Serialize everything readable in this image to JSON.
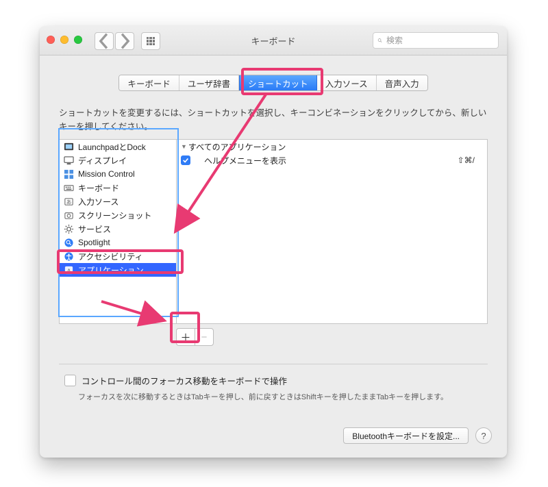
{
  "window": {
    "title": "キーボード",
    "search_placeholder": "検索"
  },
  "tabs": [
    {
      "label": "キーボード"
    },
    {
      "label": "ユーザ辞書"
    },
    {
      "label": "ショートカット",
      "active": true
    },
    {
      "label": "入力ソース"
    },
    {
      "label": "音声入力"
    }
  ],
  "instructions": "ショートカットを変更するには、ショートカットを選択し、キーコンビネーションをクリックしてから、新しいキーを押してください。",
  "categories": [
    {
      "label": "LaunchpadとDock",
      "icon": "launchpad"
    },
    {
      "label": "ディスプレイ",
      "icon": "display"
    },
    {
      "label": "Mission Control",
      "icon": "mission"
    },
    {
      "label": "キーボード",
      "icon": "keyboard"
    },
    {
      "label": "入力ソース",
      "icon": "input"
    },
    {
      "label": "スクリーンショット",
      "icon": "screenshot"
    },
    {
      "label": "サービス",
      "icon": "services"
    },
    {
      "label": "Spotlight",
      "icon": "spotlight"
    },
    {
      "label": "アクセシビリティ",
      "icon": "accessibility"
    },
    {
      "label": "アプリケーション",
      "icon": "app",
      "selected": true
    }
  ],
  "right": {
    "group": "すべてのアプリケーション",
    "items": [
      {
        "checked": true,
        "label": "ヘルプメニューを表示",
        "shortcut": "⇧⌘/"
      }
    ]
  },
  "focus": {
    "label": "コントロール間のフォーカス移動をキーボードで操作",
    "note": "フォーカスを次に移動するときはTabキーを押し、前に戻すときはShiftキーを押したままTabキーを押します。"
  },
  "bluetooth_btn": "Bluetoothキーボードを設定...",
  "help_label": "?",
  "colors": {
    "accent": "#e83a72",
    "focus": "#5aa7ff",
    "select": "#3366ff"
  }
}
